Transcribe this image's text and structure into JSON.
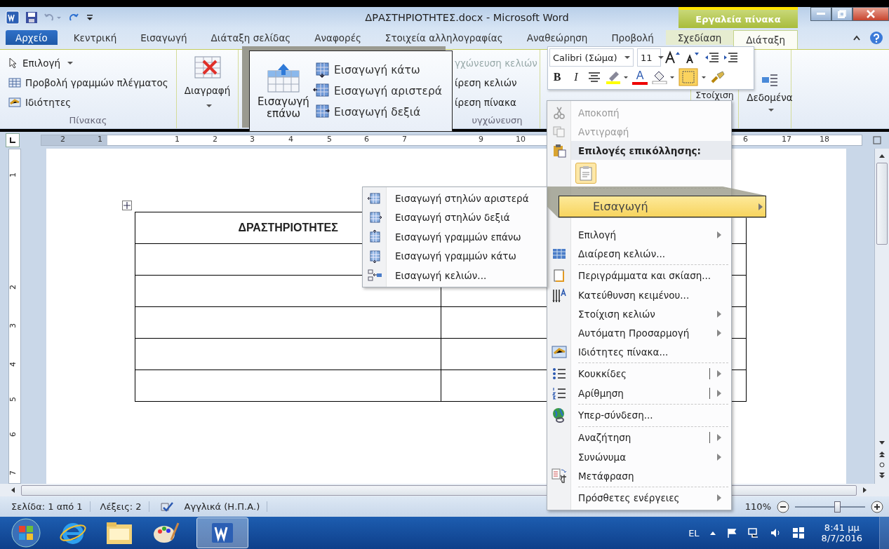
{
  "window": {
    "title": "ΔΡΑΣΤΗΡΙΟΤΗΤΕΣ.docx - Microsoft Word",
    "context_title": "Εργαλεία πίνακα"
  },
  "tabs": [
    {
      "label": "Αρχείο",
      "selected": false,
      "kind": "file"
    },
    {
      "label": "Κεντρική",
      "selected": false,
      "kind": "tab"
    },
    {
      "label": "Εισαγωγή",
      "selected": false,
      "kind": "tab"
    },
    {
      "label": "Διάταξη σελίδας",
      "selected": false,
      "kind": "tab"
    },
    {
      "label": "Αναφορές",
      "selected": false,
      "kind": "tab"
    },
    {
      "label": "Στοιχεία αλληλογραφίας",
      "selected": false,
      "kind": "tab"
    },
    {
      "label": "Αναθεώρηση",
      "selected": false,
      "kind": "tab"
    },
    {
      "label": "Προβολή",
      "selected": false,
      "kind": "tab"
    },
    {
      "label": "Σχεδίαση",
      "selected": false,
      "kind": "context"
    },
    {
      "label": "Διάταξη",
      "selected": true,
      "kind": "context"
    }
  ],
  "ribbon": {
    "table_group": {
      "items": [
        "Επιλογή",
        "Προβολή γραμμών πλέγματος",
        "Ιδιότητες"
      ],
      "label": "Πίνακας"
    },
    "delete": "Διαγραφή",
    "merge_group": {
      "items": [
        "γχώνευση κελιών",
        "ίρεση κελιών",
        "ίρεση πίνακα"
      ],
      "label": "υγχώνευση"
    },
    "align": "Στοίχιση",
    "data": "Δεδομένα"
  },
  "callout": {
    "big": "Εισαγωγή επάνω",
    "items": [
      "Εισαγωγή κάτω",
      "Εισαγωγή αριστερά",
      "Εισαγωγή δεξιά"
    ]
  },
  "mini_toolbar": {
    "font": "Calibri (Σώμα)",
    "size": "11",
    "bold": "B",
    "italic": "I",
    "font_color": "A"
  },
  "ruler": {
    "h": [
      "2",
      "1",
      "1",
      "2",
      "3",
      "4",
      "5",
      "6",
      "7",
      "9",
      "10",
      "6",
      "17",
      "18"
    ],
    "v": [
      "1",
      "2",
      "3",
      "4",
      "5",
      "6",
      "7"
    ]
  },
  "table": {
    "header": "ΔΡΑΣΤΗΡΙΟΤΗΤΕΣ"
  },
  "submenu": [
    "Εισαγωγή στηλών αριστερά",
    "Εισαγωγή στηλών δεξιά",
    "Εισαγωγή γραμμών επάνω",
    "Εισαγωγή γραμμών κάτω",
    "Εισαγωγή κελιών..."
  ],
  "magnified_item": {
    "label": "Εισαγωγή",
    "selected": true
  },
  "context_menu": [
    {
      "kind": "item",
      "label": "Αποκοπή",
      "disabled": true,
      "submenu": false,
      "split": false,
      "separator_above": false
    },
    {
      "kind": "item",
      "label": "Αντιγραφή",
      "disabled": true,
      "submenu": false,
      "split": false,
      "separator_above": false
    },
    {
      "kind": "header",
      "label": "Επιλογές επικόλλησης:"
    },
    {
      "kind": "paste"
    },
    {
      "kind": "covered"
    },
    {
      "kind": "item",
      "label": "Επιλογή",
      "disabled": false,
      "submenu": true,
      "split": false,
      "separator_above": false
    },
    {
      "kind": "item",
      "label": "Διαίρεση κελιών...",
      "disabled": false,
      "submenu": false,
      "split": false,
      "separator_above": false
    },
    {
      "kind": "item",
      "label": "Περιγράμματα και σκίαση...",
      "disabled": false,
      "submenu": false,
      "split": false,
      "separator_above": true
    },
    {
      "kind": "item",
      "label": "Κατεύθυνση κειμένου...",
      "disabled": false,
      "submenu": false,
      "split": false,
      "separator_above": false
    },
    {
      "kind": "item",
      "label": "Στοίχιση κελιών",
      "disabled": false,
      "submenu": true,
      "split": false,
      "separator_above": false
    },
    {
      "kind": "item",
      "label": "Αυτόματη Προσαρμογή",
      "disabled": false,
      "submenu": true,
      "split": false,
      "separator_above": false
    },
    {
      "kind": "item",
      "label": "Ιδιότητες πίνακα...",
      "disabled": false,
      "submenu": false,
      "split": false,
      "separator_above": false
    },
    {
      "kind": "item",
      "label": "Κουκκίδες",
      "disabled": false,
      "submenu": true,
      "split": true,
      "separator_above": true
    },
    {
      "kind": "item",
      "label": "Αρίθμηση",
      "disabled": false,
      "submenu": true,
      "split": true,
      "separator_above": false
    },
    {
      "kind": "item",
      "label": "Υπερ-σύνδεση...",
      "disabled": false,
      "submenu": false,
      "split": false,
      "separator_above": true
    },
    {
      "kind": "item",
      "label": "Αναζήτηση",
      "disabled": false,
      "submenu": true,
      "split": true,
      "separator_above": true
    },
    {
      "kind": "item",
      "label": "Συνώνυμα",
      "disabled": false,
      "submenu": true,
      "split": false,
      "separator_above": false
    },
    {
      "kind": "item",
      "label": "Μετάφραση",
      "disabled": false,
      "submenu": false,
      "split": false,
      "separator_above": false
    },
    {
      "kind": "item",
      "label": "Πρόσθετες ενέργειες",
      "disabled": false,
      "submenu": true,
      "split": false,
      "separator_above": true
    }
  ],
  "status_bar": {
    "page": "Σελίδα: 1 από 1",
    "words": "Λέξεις: 2",
    "language": "Αγγλικά (Η.Π.Α.)",
    "zoom": "110%",
    "zoom_slider": {
      "level": 0.6
    }
  },
  "taskbar": {
    "language": "EL",
    "time": "8:41 μμ",
    "date": "8/7/2016"
  }
}
